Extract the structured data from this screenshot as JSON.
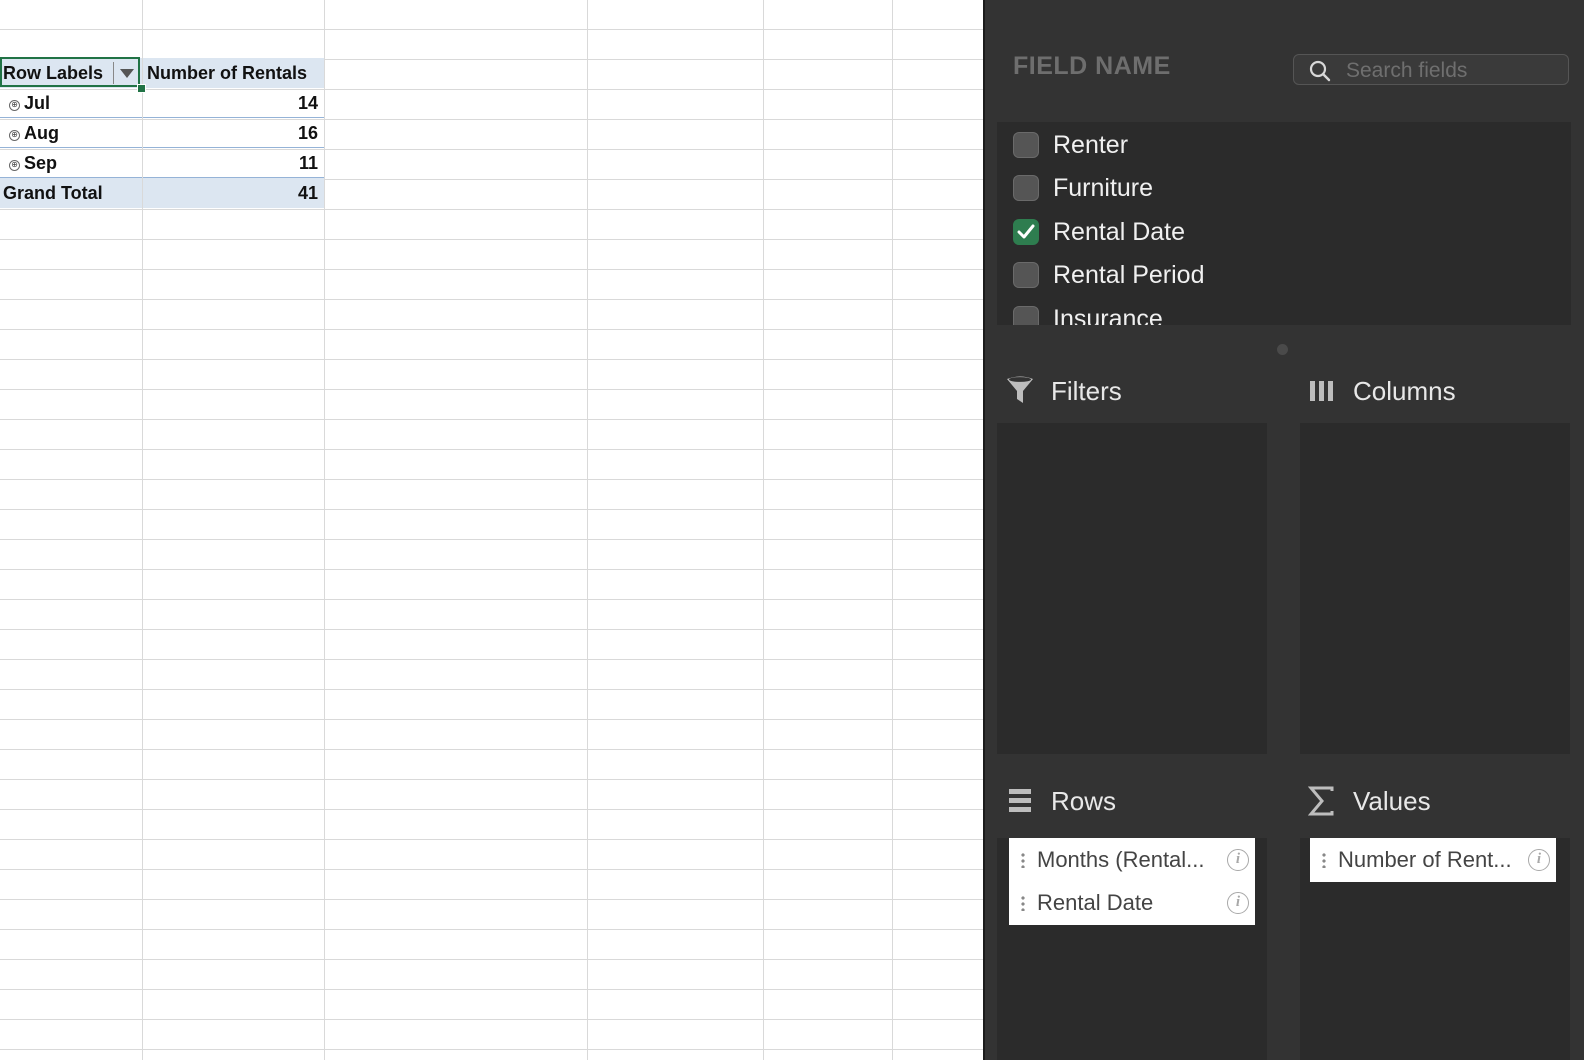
{
  "pivot": {
    "header": {
      "row_labels": "Row Labels",
      "value_header": "Number of Rentals"
    },
    "rows": [
      {
        "label": "Jul",
        "value": "14"
      },
      {
        "label": "Aug",
        "value": "16"
      },
      {
        "label": "Sep",
        "value": "11"
      }
    ],
    "grand_total": {
      "label": "Grand Total",
      "value": "41"
    },
    "expand_symbol": "⊕"
  },
  "panel": {
    "field_name_title": "FIELD NAME",
    "search": {
      "placeholder": "Search fields",
      "value": ""
    },
    "fields": [
      {
        "label": "Renter",
        "checked": false
      },
      {
        "label": "Furniture",
        "checked": false
      },
      {
        "label": "Rental Date",
        "checked": true
      },
      {
        "label": "Rental Period",
        "checked": false
      },
      {
        "label": "Insurance",
        "checked": false
      }
    ],
    "areas": {
      "filters": {
        "title": "Filters",
        "icon": "funnel-icon",
        "items": []
      },
      "columns": {
        "title": "Columns",
        "icon": "columns-icon",
        "items": []
      },
      "rows": {
        "title": "Rows",
        "icon": "rows-icon",
        "items": [
          "Months (Rental...",
          "Rental Date"
        ]
      },
      "values": {
        "title": "Values",
        "icon": "sigma-icon",
        "items": [
          "Number of Rent..."
        ]
      }
    },
    "info_symbol": "i"
  },
  "colors": {
    "accent_green": "#217346",
    "checkbox_checked": "#2e7d4f",
    "pivot_header_fill": "#dce6f1",
    "panel_bg": "#333333"
  }
}
